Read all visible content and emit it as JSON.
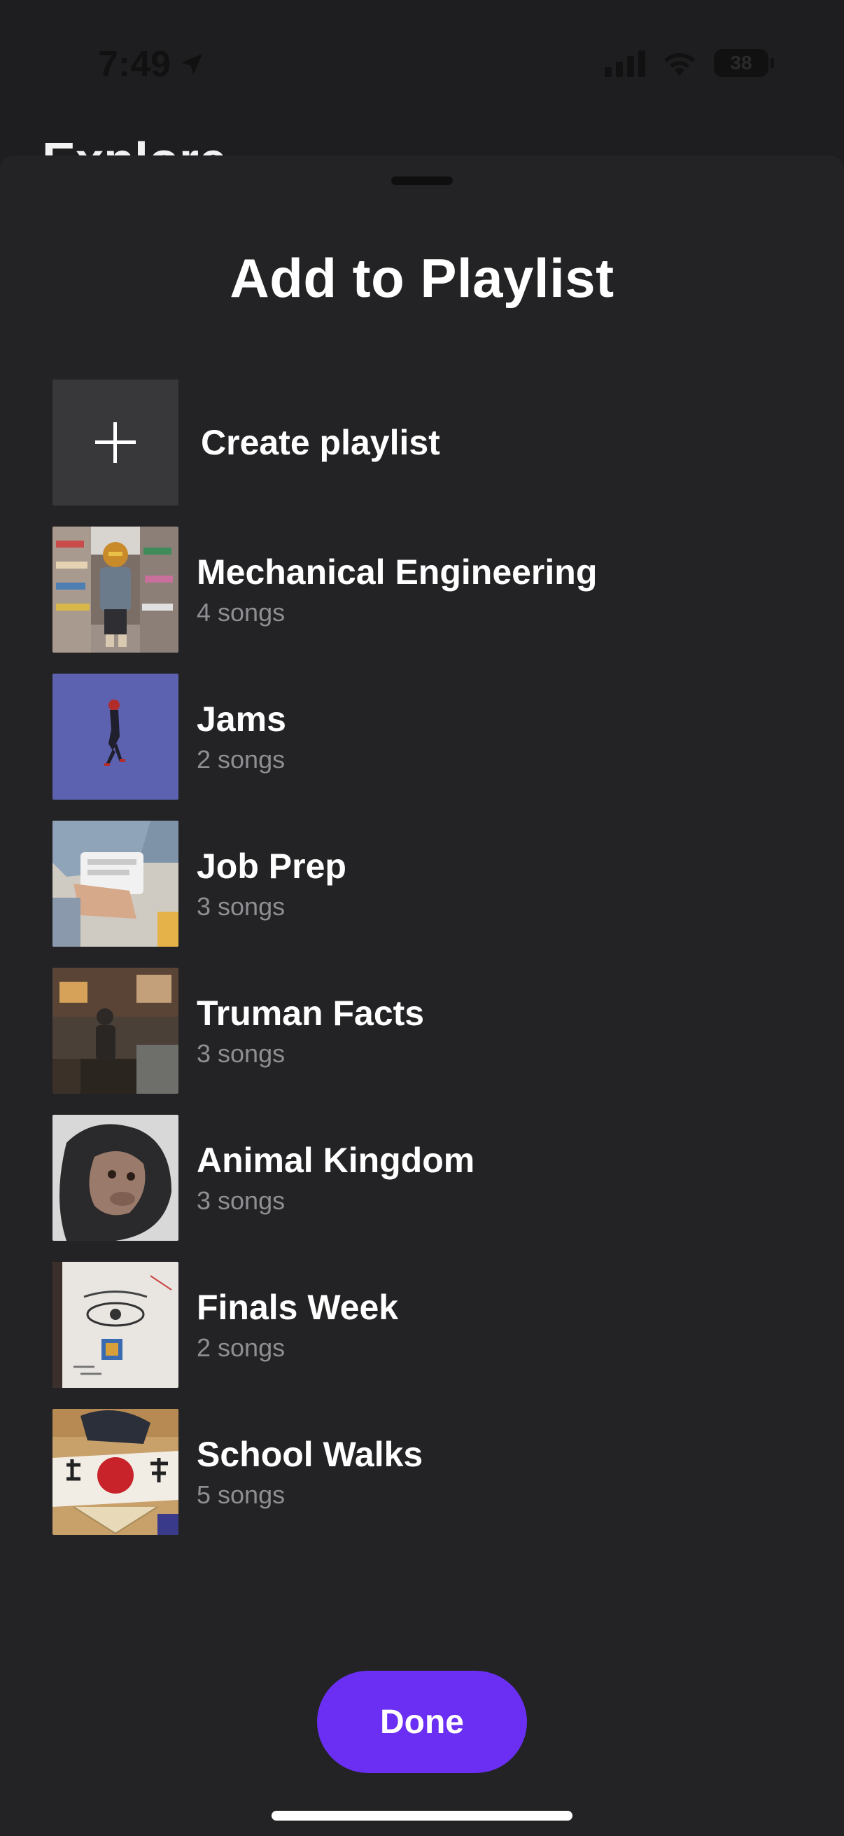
{
  "status_bar": {
    "time": "7:49",
    "battery": "38",
    "icons": [
      "location-arrow-icon",
      "cellular-signal-icon",
      "wifi-icon",
      "battery-icon"
    ]
  },
  "background_screen": {
    "title": "Explore"
  },
  "sheet": {
    "title": "Add to Playlist",
    "create_label": "Create playlist",
    "playlists": [
      {
        "name": "Mechanical Engineering",
        "count": "4 songs"
      },
      {
        "name": "Jams",
        "count": "2 songs"
      },
      {
        "name": "Job Prep",
        "count": "3 songs"
      },
      {
        "name": "Truman Facts",
        "count": "3 songs"
      },
      {
        "name": "Animal Kingdom",
        "count": "3 songs"
      },
      {
        "name": "Finals Week",
        "count": "2 songs"
      },
      {
        "name": "School Walks",
        "count": "5 songs"
      }
    ],
    "done_label": "Done"
  },
  "colors": {
    "sheet_background": "#232325",
    "accent": "#6a2ff2",
    "secondary_text": "#8e8e93"
  }
}
